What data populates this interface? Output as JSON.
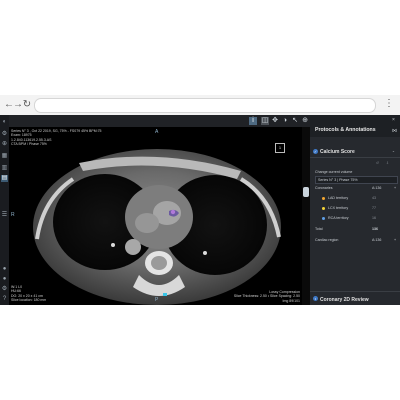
{
  "browser": {
    "back_icon": "back-arrow-icon",
    "forward_icon": "forward-arrow-icon",
    "reload_icon": "reload-icon"
  },
  "overlay": {
    "top_left": [
      "Series N° 3 , Oct 22 2019, SG, 75% - FS079 45% BPM:75",
      "Exam: 18975",
      "1.2.840.113619.2.55.3.AS",
      "CTA BPM / Phase 75%"
    ],
    "bottom_left": [
      "W:1 L0",
      "HU:66",
      "DG: 20 x 20 x 41 cm",
      "Slice location: 180 mm"
    ],
    "bottom_right": [
      "Lossy Compression",
      "Slice Thickness: 2.50 • Slice Spacing: 2.50",
      "Img 89/101"
    ],
    "orient_top": "A",
    "orient_left": "R",
    "orient_bottom": "P",
    "box_label": "1"
  },
  "panel": {
    "title": "Protocols & Annotations",
    "section": "Calcium Score",
    "change_label": "Change current volume",
    "series_value": "Series N° 3 | Phase 75%",
    "coronaries_label": "Coronaries",
    "coronaries_score": "A:136",
    "territories": [
      {
        "name": "LAD territory",
        "value": "43",
        "color": "#f2a531"
      },
      {
        "name": "LCX territory",
        "value": "77",
        "color": "#f4d337"
      },
      {
        "name": "RCA territory",
        "value": "16",
        "color": "#5e9ee6"
      }
    ],
    "total_label": "Total",
    "total_value": "136",
    "cardiac_label": "Cardiac region",
    "cardiac_value": "A:136",
    "review_label": "Coronary 2D Review"
  }
}
